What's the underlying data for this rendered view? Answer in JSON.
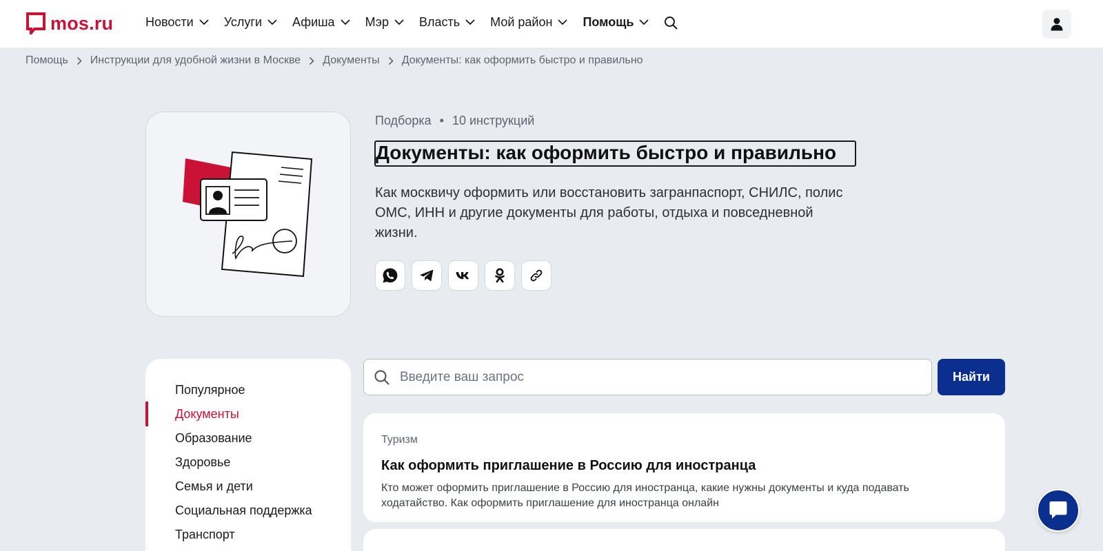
{
  "header": {
    "logo_text": "mos.ru",
    "nav": [
      {
        "label": "Новости"
      },
      {
        "label": "Услуги"
      },
      {
        "label": "Афиша"
      },
      {
        "label": "Мэр"
      },
      {
        "label": "Власть"
      },
      {
        "label": "Мой район"
      },
      {
        "label": "Помощь"
      }
    ]
  },
  "breadcrumbs": [
    "Помощь",
    "Инструкции для удобной жизни в Москве",
    "Документы",
    "Документы: как оформить быстро и правильно"
  ],
  "hero": {
    "meta_type": "Подборка",
    "meta_separator": "•",
    "meta_count": "10 инструкций",
    "title": "Документы: как оформить быстро и правильно",
    "description": "Как москвичу оформить или восстановить загранпаспорт, СНИЛС, полис ОМС, ИНН и другие документы для работы, отдыха и повседневной жизни.",
    "share": [
      "whatsapp-icon",
      "telegram-icon",
      "vk-icon",
      "odnoklassniki-icon",
      "link-icon"
    ]
  },
  "sidebar": {
    "items": [
      {
        "label": "Популярное"
      },
      {
        "label": "Документы"
      },
      {
        "label": "Образование"
      },
      {
        "label": "Здоровье"
      },
      {
        "label": "Семья и дети"
      },
      {
        "label": "Социальная поддержка"
      },
      {
        "label": "Транспорт"
      }
    ],
    "active_index": 1
  },
  "search": {
    "placeholder": "Введите ваш запрос",
    "button_label": "Найти"
  },
  "cards": [
    {
      "tag": "Туризм",
      "title": "Как оформить приглашение в Россию для иностранца",
      "text": "Кто может оформить приглашение в Россию для иностранца, какие нужны документы и куда подавать ходатайство. Как оформить приглашение для иностранца онлайн"
    }
  ],
  "colors": {
    "brand_red": "#cc1136",
    "primary_blue": "#0b2f8e",
    "page_bg": "#e8ebf0"
  }
}
